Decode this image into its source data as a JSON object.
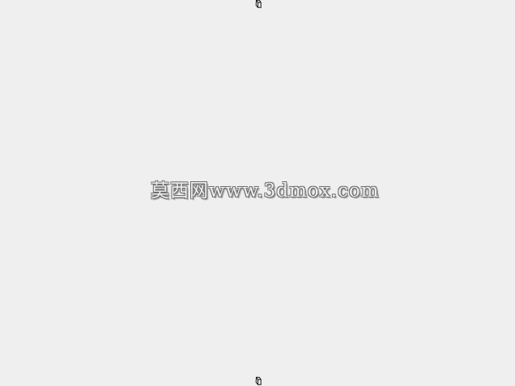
{
  "watermark": {
    "text": "莫西网www.3dmox.com"
  },
  "icons": {
    "top_marker": "cube-marker-icon",
    "bottom_marker": "cube-marker-icon"
  }
}
